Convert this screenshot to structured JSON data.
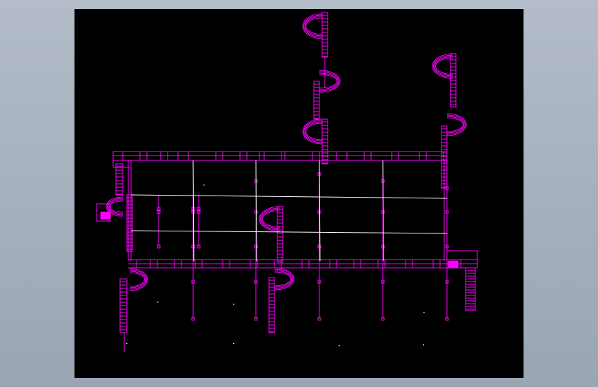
{
  "viewport": {
    "name": "cad-drawing-viewport",
    "background": "#000000"
  },
  "drawing": {
    "stroke_color": "#ff00ff",
    "secondary_color": "#ffffff",
    "fill_accent": "#ff00ff"
  }
}
